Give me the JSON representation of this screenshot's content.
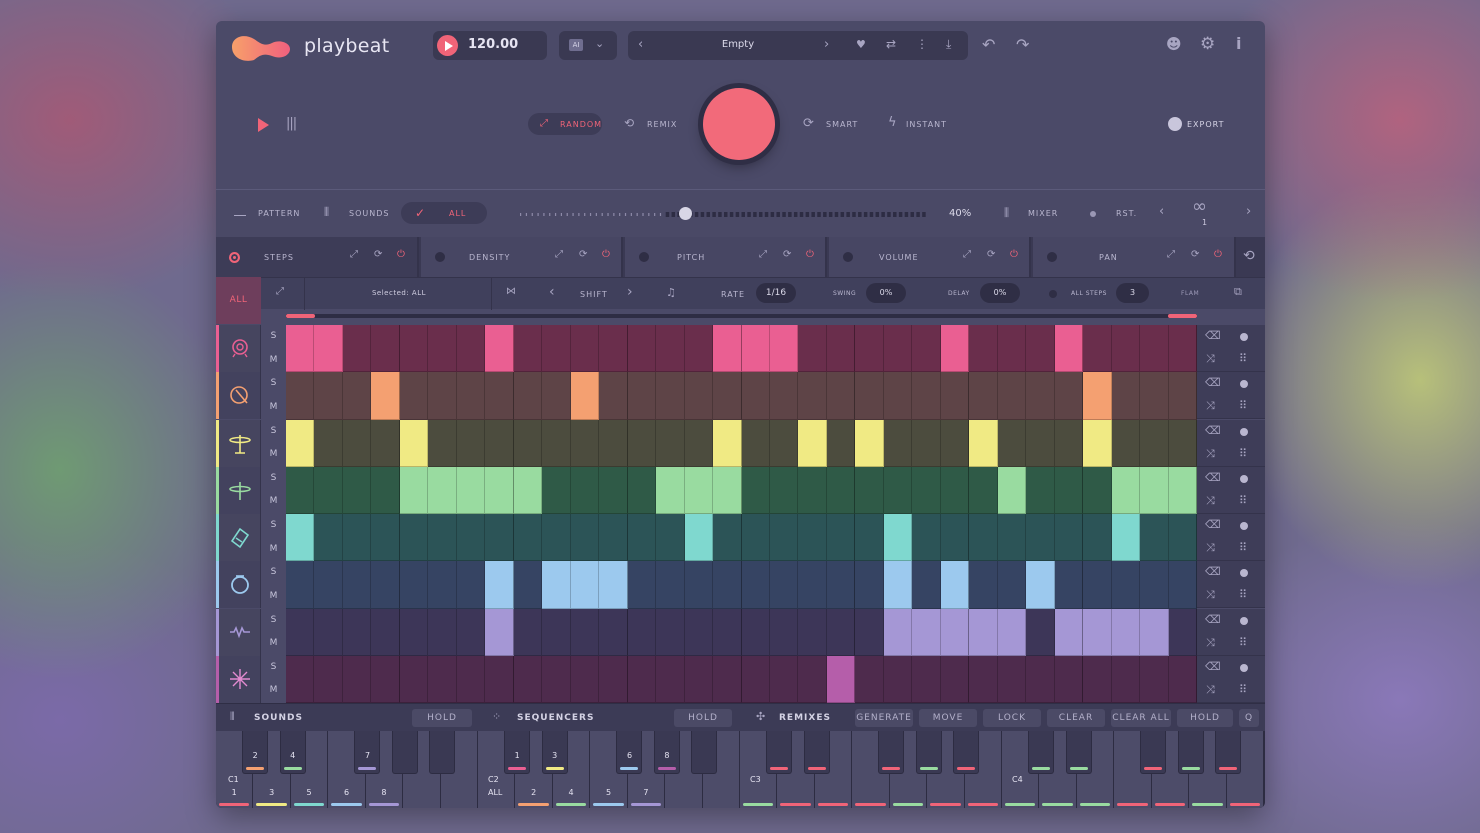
{
  "app": {
    "name": "playbeat"
  },
  "header": {
    "tempo": "120.00",
    "ai_label": "AI",
    "preset": "Empty"
  },
  "generator": {
    "random": "RANDOM",
    "remix": "REMIX",
    "smart": "SMART",
    "instant": "INSTANT",
    "export": "EXPORT"
  },
  "controls": {
    "pattern": "PATTERN",
    "sounds": "SOUNDS",
    "all": "ALL",
    "percent": "40%",
    "mixer": "MIXER",
    "rst": "RST.",
    "page": "1"
  },
  "tabs": {
    "steps": "STEPS",
    "density": "DENSITY",
    "pitch": "PITCH",
    "volume": "VOLUME",
    "pan": "PAN"
  },
  "subbar": {
    "all": "ALL",
    "selected": "Selected: ALL",
    "shift": "SHIFT",
    "rate_label": "RATE",
    "rate": "1/16",
    "swing_label": "SWING",
    "swing": "0%",
    "delay_label": "DELAY",
    "delay": "0%",
    "all_steps_label": "ALL STEPS",
    "all_steps": "3",
    "flam": "FLAM"
  },
  "solo": "S",
  "mute": "M",
  "colors": {
    "accent": "#f06478"
  },
  "tracks": [
    {
      "icon": "kick-drum-icon",
      "on": "#ea5f92",
      "off": "#6a2e4c",
      "steps": [
        0,
        1,
        7,
        15,
        16,
        17,
        23,
        27
      ]
    },
    {
      "icon": "snare-icon",
      "on": "#f4a071",
      "off": "#5e4447",
      "steps": [
        3,
        10,
        28
      ]
    },
    {
      "icon": "hihat-closed-icon",
      "on": "#f0ea84",
      "off": "#4c4c3e",
      "steps": [
        0,
        4,
        15,
        18,
        20,
        24,
        28
      ]
    },
    {
      "icon": "hihat-open-icon",
      "on": "#99dba0",
      "off": "#2f5a47",
      "steps": [
        4,
        5,
        6,
        7,
        8,
        13,
        14,
        15,
        25,
        29,
        30,
        31
      ]
    },
    {
      "icon": "clap-icon",
      "on": "#7fd8cf",
      "off": "#2c5457",
      "steps": [
        0,
        14,
        21,
        29
      ]
    },
    {
      "icon": "tambourine-icon",
      "on": "#9cc9ee",
      "off": "#364463",
      "steps": [
        7,
        9,
        10,
        11,
        21,
        23,
        26
      ]
    },
    {
      "icon": "wave-icon",
      "on": "#a597d5",
      "off": "#3d3658",
      "steps": [
        7,
        21,
        22,
        23,
        24,
        25,
        27,
        28,
        29,
        30
      ]
    },
    {
      "icon": "sparkle-icon",
      "on": "#b55eaa",
      "off": "#4e2b4d",
      "steps": [
        19
      ]
    }
  ],
  "bottom": {
    "sounds": "SOUNDS",
    "hold1": "HOLD",
    "sequencers": "SEQUENCERS",
    "hold2": "HOLD",
    "remixes": "REMIXES",
    "generate": "GENERATE",
    "move": "MOVE",
    "lock": "LOCK",
    "clear": "CLEAR",
    "clear_all": "CLEAR ALL",
    "hold3": "HOLD",
    "search": "Q"
  },
  "keyboard": {
    "c1": "C1",
    "c2": "C2",
    "c2_all": "ALL",
    "c3": "C3",
    "c4": "C4",
    "k1": "1",
    "k2": "2",
    "k3": "3",
    "k4": "4",
    "k5": "5",
    "k6": "6",
    "k7": "7",
    "k8": "8"
  }
}
